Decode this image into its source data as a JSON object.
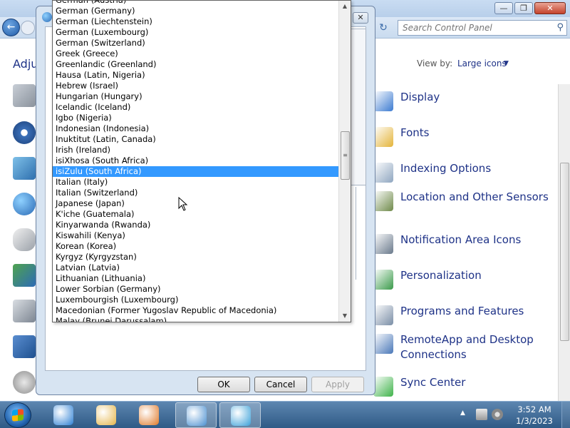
{
  "control_panel": {
    "search_placeholder": "Search Control Panel",
    "heading": "Adju",
    "view_by_label": "View by:",
    "view_by_value": "Large icons",
    "items": [
      {
        "label": "Display",
        "icon": "display-icon",
        "color": "#3c7bd1"
      },
      {
        "label": "Fonts",
        "icon": "fonts-icon",
        "color": "#e4b43a"
      },
      {
        "label": "Indexing Options",
        "icon": "indexing-options-icon",
        "color": "#8fa6c0"
      },
      {
        "label": "Location and Other Sensors",
        "icon": "location-sensors-icon",
        "color": "#6f8a4a"
      },
      {
        "label": "Notification Area Icons",
        "icon": "notification-area-icon",
        "color": "#6a7a8c"
      },
      {
        "label": "Personalization",
        "icon": "personalization-icon",
        "color": "#3a9a4a"
      },
      {
        "label": "Programs and Features",
        "icon": "programs-features-icon",
        "color": "#7a8ea6"
      },
      {
        "label": "RemoteApp and Desktop Connections",
        "icon": "remoteapp-icon",
        "color": "#4a78b8"
      },
      {
        "label": "Sync Center",
        "icon": "sync-center-icon",
        "color": "#3fb34a"
      }
    ]
  },
  "dialog": {
    "ok_label": "OK",
    "cancel_label": "Cancel",
    "apply_label": "Apply"
  },
  "dropdown": {
    "items": [
      "German (Austria)",
      "German (Germany)",
      "German (Liechtenstein)",
      "German (Luxembourg)",
      "German (Switzerland)",
      "Greek (Greece)",
      "Greenlandic (Greenland)",
      "Hausa (Latin, Nigeria)",
      "Hebrew (Israel)",
      "Hungarian (Hungary)",
      "Icelandic (Iceland)",
      "Igbo (Nigeria)",
      "Indonesian (Indonesia)",
      "Inuktitut (Latin, Canada)",
      "Irish (Ireland)",
      "isiXhosa (South Africa)",
      "isiZulu (South Africa)",
      "Italian (Italy)",
      "Italian (Switzerland)",
      "Japanese (Japan)",
      "K'iche (Guatemala)",
      "Kinyarwanda (Rwanda)",
      "Kiswahili (Kenya)",
      "Korean (Korea)",
      "Kyrgyz (Kyrgyzstan)",
      "Latvian (Latvia)",
      "Lithuanian (Lithuania)",
      "Lower Sorbian (Germany)",
      "Luxembourgish (Luxembourg)",
      "Macedonian (Former Yugoslav Republic of Macedonia)",
      "Malay (Brunei Darussalam)"
    ],
    "selected": "isiZulu (South Africa)"
  },
  "taskbar": {
    "time": "3:52 AM",
    "date": "1/3/2023",
    "pinned": [
      {
        "name": "internet-explorer-icon",
        "color": "#2d7fd3"
      },
      {
        "name": "windows-explorer-icon",
        "color": "#e5b54a"
      },
      {
        "name": "media-player-icon",
        "color": "#e07a2a"
      },
      {
        "name": "control-panel-icon",
        "color": "#4a8fd0"
      },
      {
        "name": "region-language-icon",
        "color": "#3aa0d8"
      }
    ]
  }
}
